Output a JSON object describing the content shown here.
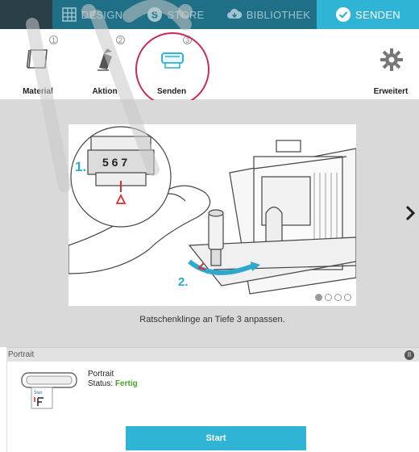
{
  "topnav": {
    "tabs": [
      {
        "label": "DESIGN",
        "icon": "design-grid-icon"
      },
      {
        "label": "STORE",
        "icon": "store-s-icon"
      },
      {
        "label": "BIBLIOTHEK",
        "icon": "cloud-library-icon"
      },
      {
        "label": "SENDEN",
        "icon": "check-circle-icon",
        "active": true
      }
    ],
    "active_color": "#2fb4d6",
    "bar_color": "#1f6f86"
  },
  "steps": [
    {
      "number": "1",
      "label": "Material",
      "icon": "material-sheet-icon"
    },
    {
      "number": "2",
      "label": "Aktion",
      "icon": "blade-action-icon"
    },
    {
      "number": "3",
      "label": "Senden",
      "icon": "send-machine-icon"
    }
  ],
  "advanced": {
    "label": "Erweitert",
    "icon": "gear-icon"
  },
  "preview": {
    "caption": "Ratschenklinge an Tiefe 3 anpassen.",
    "callout_1": "1.",
    "callout_2": "2.",
    "dial_numbers": "5 6 7",
    "page_index": 1,
    "page_count": 4
  },
  "device": {
    "section_title": "Portrait",
    "name": "Portrait",
    "status_label": "Status:",
    "status_value": "Fertig",
    "status_color": "#4aa52c",
    "start_label": "Start"
  }
}
